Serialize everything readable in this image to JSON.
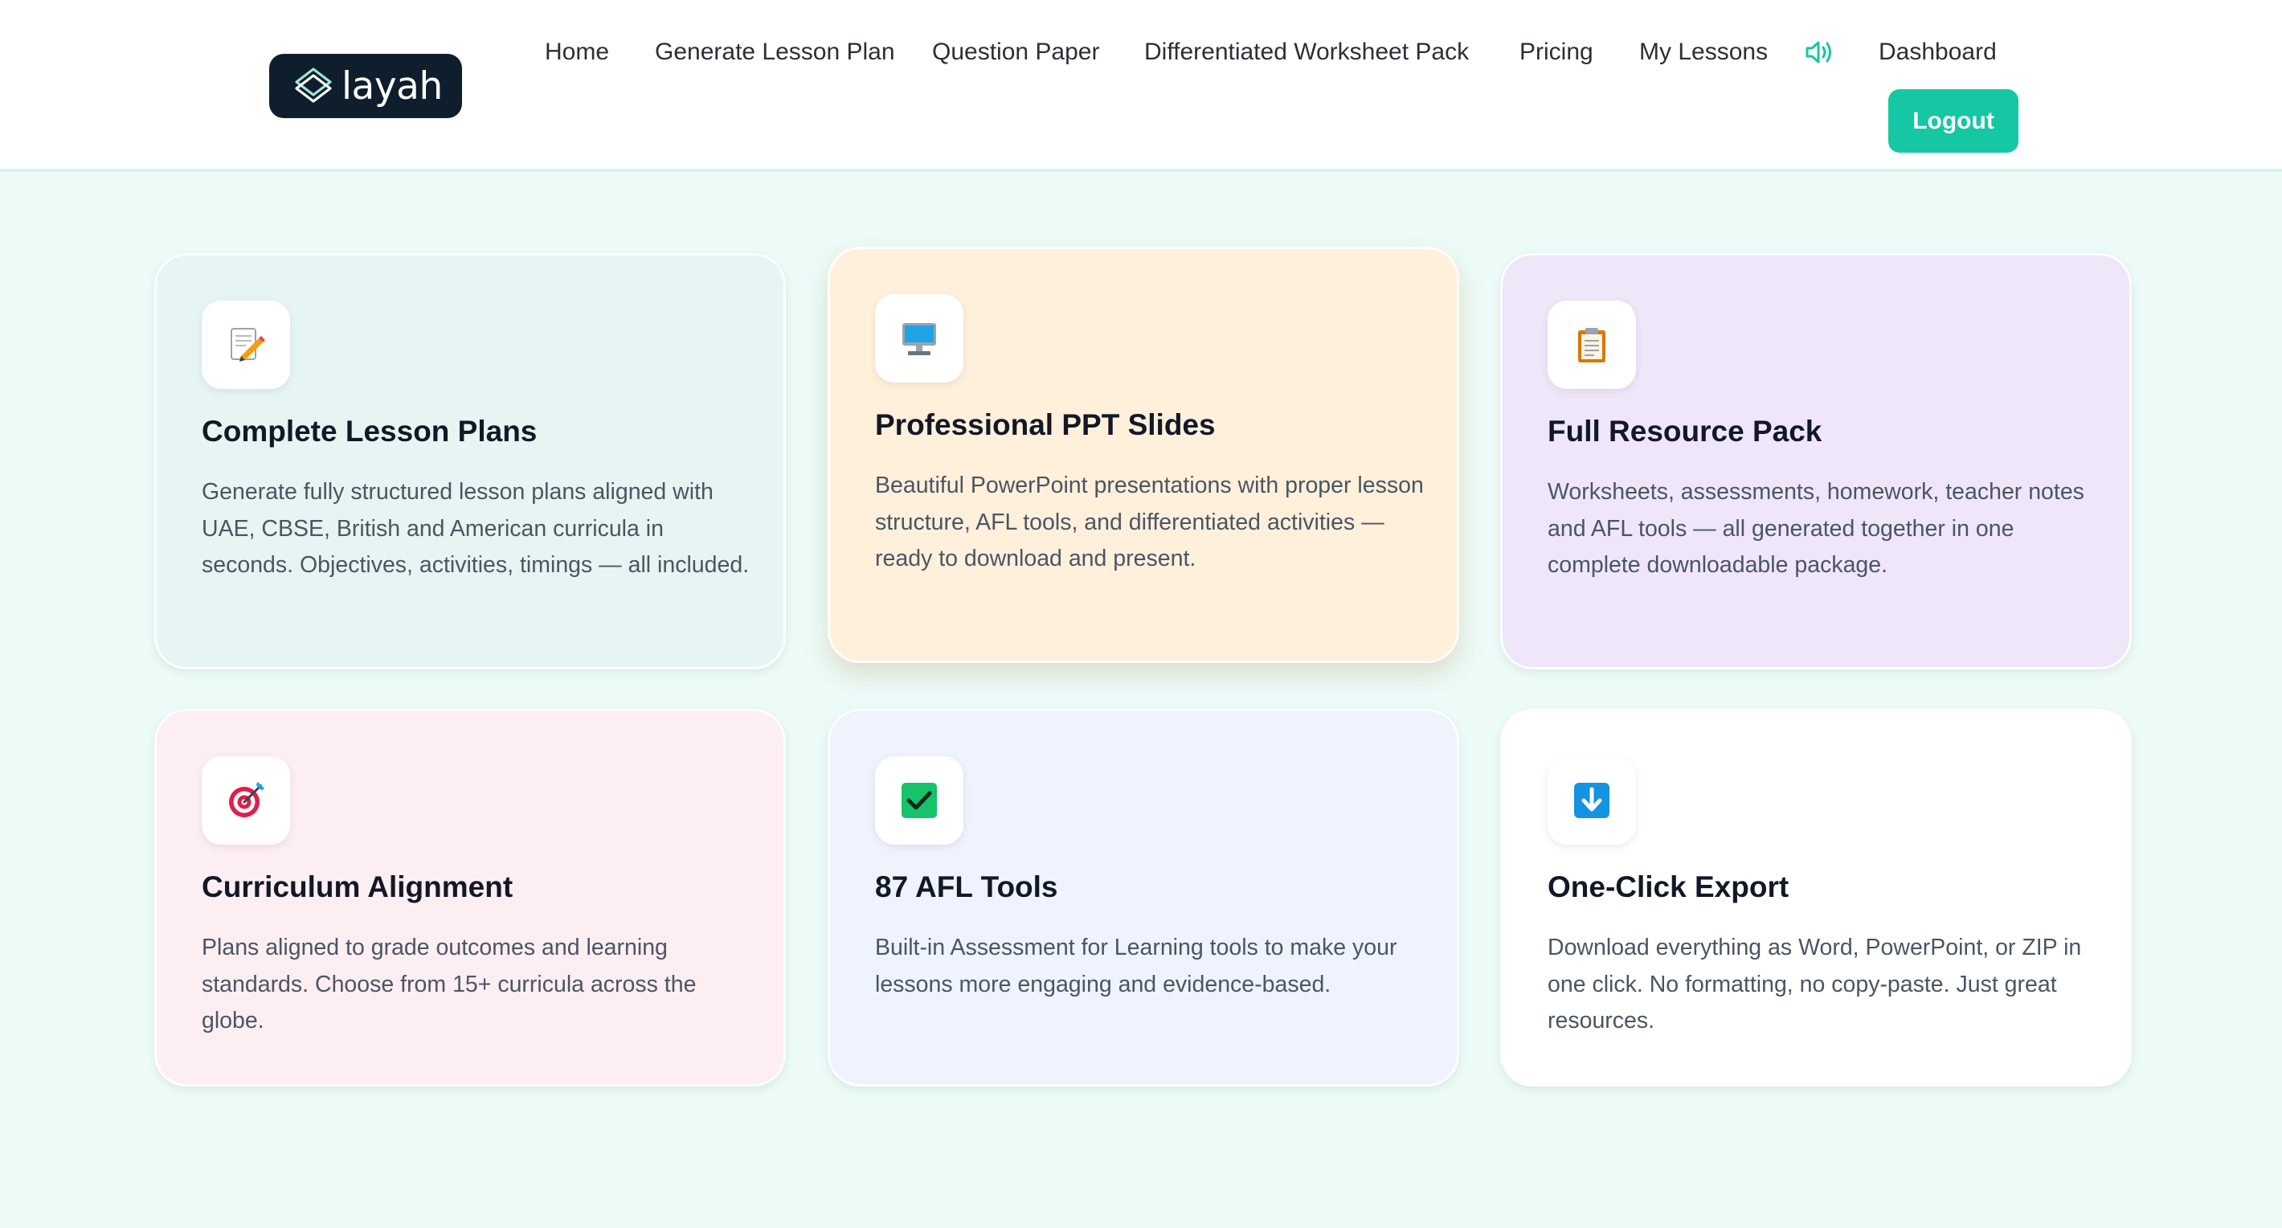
{
  "brand": {
    "name": "layah"
  },
  "nav": {
    "items": [
      {
        "label": "Home"
      },
      {
        "label": "Generate Lesson Plan"
      },
      {
        "label": "Question Paper"
      },
      {
        "label": "Differentiated Worksheet Pack"
      },
      {
        "label": "Pricing"
      },
      {
        "label": "My Lessons"
      },
      {
        "label": "Dashboard"
      }
    ],
    "sound_icon": "speaker-icon",
    "logout_label": "Logout"
  },
  "colors": {
    "accent": "#15c7a3",
    "logo_bg": "#0f1e2c",
    "page_bg": "#ecfbf7"
  },
  "features": [
    {
      "icon": "memo-pencil-icon",
      "title": "Complete Lesson Plans",
      "description": "Generate fully structured lesson plans aligned with UAE, CBSE, British and American curricula in seconds. Objectives, activities, timings — all included.",
      "bg": "#e6f5f3"
    },
    {
      "icon": "desktop-computer-icon",
      "title": "Professional PPT Slides",
      "description": "Beautiful PowerPoint presentations with proper lesson structure, AFL tools, and differentiated activities — ready to download and present.",
      "bg": "#fff0dc"
    },
    {
      "icon": "clipboard-icon",
      "title": "Full Resource Pack",
      "description": "Worksheets, assessments, homework, teacher notes and AFL tools — all generated together in one complete downloadable package.",
      "bg": "#efe6fa"
    },
    {
      "icon": "target-icon",
      "title": "Curriculum Alignment",
      "description": "Plans aligned to grade outcomes and learning standards. Choose from 15+ curricula across the globe.",
      "bg": "#fdeef2"
    },
    {
      "icon": "check-box-icon",
      "title": "87 AFL Tools",
      "description": "Built-in Assessment for Learning tools to make your lessons more engaging and evidence-based.",
      "bg": "#eef3fd"
    },
    {
      "icon": "download-arrow-icon",
      "title": "One-Click Export",
      "description": "Download everything as Word, PowerPoint, or ZIP in one click. No formatting, no copy-paste. Just great resources.",
      "bg": "#ffffff"
    }
  ]
}
